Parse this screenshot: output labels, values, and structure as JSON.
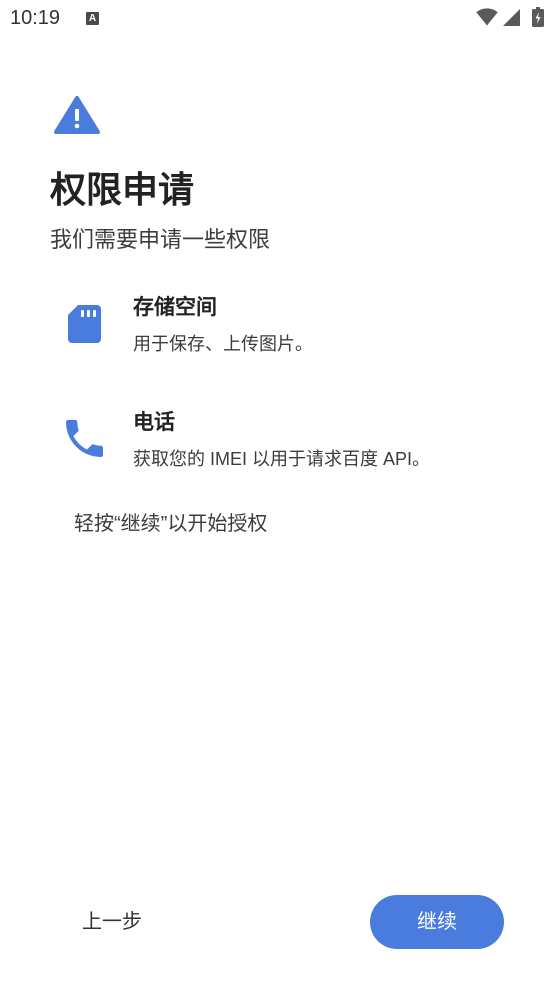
{
  "status_bar": {
    "time": "10:19",
    "notification_glyph": "A",
    "icons": [
      "wifi-icon",
      "signal-icon",
      "battery-icon"
    ]
  },
  "header": {
    "icon": "warning-icon",
    "title": "权限申请",
    "subtitle": "我们需要申请一些权限"
  },
  "permissions": [
    {
      "icon": "sd-card-icon",
      "title": "存储空间",
      "description": "用于保存、上传图片。"
    },
    {
      "icon": "phone-icon",
      "title": "电话",
      "description": "获取您的 IMEI 以用于请求百度 API。"
    }
  ],
  "hint": "轻按“继续”以开始授权",
  "footer": {
    "back_label": "上一步",
    "continue_label": "继续"
  },
  "colors": {
    "accent": "#4a7cdd",
    "text": "#1f1f1f",
    "secondary_text": "#3c3c3c",
    "background": "#ffffff"
  }
}
